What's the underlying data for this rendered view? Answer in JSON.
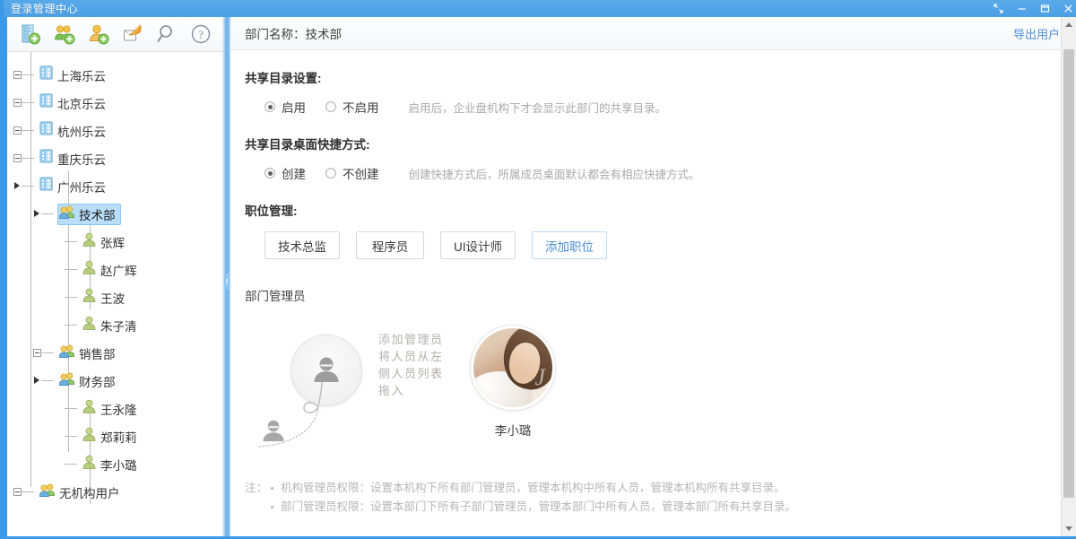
{
  "window": {
    "title": "登录管理中心",
    "controls": [
      {
        "name": "restore-fullscreen",
        "glyph": "fullscreen-icon"
      },
      {
        "name": "minimize",
        "glyph": "minimize-icon"
      },
      {
        "name": "maximize",
        "glyph": "maximize-icon"
      },
      {
        "name": "close",
        "glyph": "close-icon"
      }
    ]
  },
  "toolbar": {
    "items": [
      {
        "name": "add-organization-icon",
        "tip": "新建机构"
      },
      {
        "name": "add-department-icon",
        "tip": "新建部门"
      },
      {
        "name": "add-user-icon",
        "tip": "新建用户"
      },
      {
        "name": "import-icon",
        "tip": "导入"
      },
      {
        "name": "search-icon",
        "tip": "搜索"
      },
      {
        "name": "help-icon",
        "tip": "帮助"
      }
    ]
  },
  "tree": {
    "nodes": [
      {
        "label": "上海乐云",
        "icon": "building-icon",
        "depth": 1,
        "toggle": "plus",
        "selected": false
      },
      {
        "label": "北京乐云",
        "icon": "building-icon",
        "depth": 1,
        "toggle": "plus",
        "selected": false
      },
      {
        "label": "杭州乐云",
        "icon": "building-icon",
        "depth": 1,
        "toggle": "plus",
        "selected": false
      },
      {
        "label": "重庆乐云",
        "icon": "building-icon",
        "depth": 1,
        "toggle": "plus",
        "selected": false
      },
      {
        "label": "广州乐云",
        "icon": "building-icon",
        "depth": 1,
        "toggle": "expanded",
        "selected": false
      },
      {
        "label": "技术部",
        "icon": "group-icon",
        "depth": 2,
        "toggle": "expanded",
        "selected": true
      },
      {
        "label": "张辉",
        "icon": "user-icon",
        "depth": 3,
        "toggle": "none",
        "selected": false
      },
      {
        "label": "赵广辉",
        "icon": "user-icon",
        "depth": 3,
        "toggle": "none",
        "selected": false
      },
      {
        "label": "王波",
        "icon": "user-icon",
        "depth": 3,
        "toggle": "none",
        "selected": false
      },
      {
        "label": "朱子清",
        "icon": "user-icon",
        "depth": 3,
        "toggle": "none",
        "selected": false
      },
      {
        "label": "销售部",
        "icon": "group-icon",
        "depth": 2,
        "toggle": "plus",
        "selected": false
      },
      {
        "label": "财务部",
        "icon": "group-icon",
        "depth": 2,
        "toggle": "expanded",
        "selected": false
      },
      {
        "label": "王永隆",
        "icon": "user-icon",
        "depth": 3,
        "toggle": "none",
        "selected": false
      },
      {
        "label": "郑莉莉",
        "icon": "user-icon",
        "depth": 3,
        "toggle": "none",
        "selected": false
      },
      {
        "label": "李小璐",
        "icon": "user-icon",
        "depth": 3,
        "toggle": "none",
        "selected": false
      },
      {
        "label": "无机构用户",
        "icon": "group-icon",
        "depth": 1,
        "toggle": "plus",
        "selected": false
      }
    ]
  },
  "content": {
    "header": {
      "dept_title": "部门名称：技术部",
      "export_label": "导出用户"
    },
    "share_dir": {
      "title": "共享目录设置:",
      "option_on": "启用",
      "option_off": "不启用",
      "selected": "启用",
      "hint": "启用后，企业盘机构下才会显示此部门的共享目录。"
    },
    "shortcut": {
      "title": "共享目录桌面快捷方式:",
      "option_on": "创建",
      "option_off": "不创建",
      "selected": "创建",
      "hint": "创建快捷方式后，所属成员桌面默认都会有相应快捷方式。"
    },
    "positions": {
      "title": "职位管理:",
      "buttons": [
        "技术总监",
        "程序员",
        "UI设计师"
      ],
      "add_label": "添加职位"
    },
    "admins": {
      "title": "部门管理员",
      "drop_hint": "添加管理员\n将人员从左\n侧人员列表\n拖入",
      "drop_hint_lines": [
        "添加管理员",
        "将人员从左",
        "侧人员列表",
        "拖入"
      ],
      "list": [
        {
          "name": "李小璐",
          "avatar": "portrait-photo"
        }
      ]
    },
    "notes": {
      "label": "注：",
      "items": [
        "机构管理员权限：设置本机构下所有部门管理员，管理本机构中所有人员，管理本机构所有共享目录。",
        "部门管理员权限：设置本部门下所有子部门管理员，管理本部门中所有人员，管理本部门所有共享目录。"
      ]
    }
  },
  "colors": {
    "accent": "#3a9ae8",
    "link": "#4a90d9",
    "selection": "#b8defa",
    "hint_text": "#a9a9a9"
  }
}
